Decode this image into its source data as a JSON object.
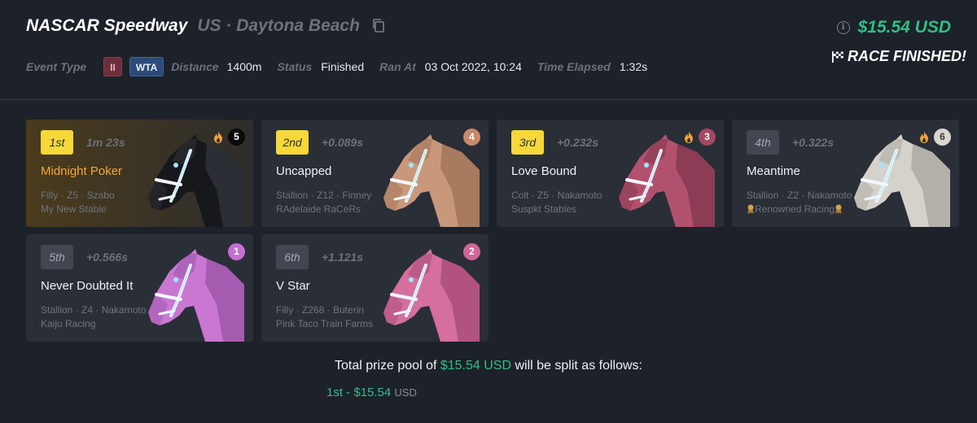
{
  "race": {
    "track": "NASCAR Speedway",
    "location": "US · Daytona Beach",
    "prize": "$15.54 USD",
    "status_banner": "RACE FINISHED!",
    "labels": {
      "event_type": "Event Type",
      "distance": "Distance",
      "status": "Status",
      "ran_at": "Ran At",
      "time_elapsed": "Time Elapsed"
    },
    "class_badge": "II",
    "event_type": "WTA",
    "distance": "1400m",
    "status": "Finished",
    "ran_at": "03 Oct 2022, 10:24",
    "time_elapsed": "1:32s"
  },
  "results": [
    {
      "position": "1st",
      "gap": "1m 23s",
      "name": "Midnight Poker",
      "meta": "Filly · Z5 · Szabo",
      "stable": "My New Stable",
      "gate": "5",
      "gate_bg": "#0a0a0a",
      "gate_fg": "#ffffff",
      "coat": "#17181c",
      "shade": "#2c2e35",
      "hot": true
    },
    {
      "position": "2nd",
      "gap": "+0.089s",
      "name": "Uncapped",
      "meta": "Stallion · Z12 · Finney",
      "stable": "RAdelaide RaCeRs",
      "gate": "4",
      "gate_bg": "#c78a68",
      "gate_fg": "#ffffff",
      "coat": "#c9987a",
      "shade": "#a87a5e",
      "hot": false
    },
    {
      "position": "3rd",
      "gap": "+0.232s",
      "name": "Love Bound",
      "meta": "Colt · Z5 · Nakamoto",
      "stable": "Suspkt Stables",
      "gate": "3",
      "gate_bg": "#a24a63",
      "gate_fg": "#ffffff",
      "coat": "#b2516d",
      "shade": "#8c3c54",
      "hot": true
    },
    {
      "position": "4th",
      "gap": "+0.322s",
      "name": "Meantime",
      "meta": "Stallion · Z2 · Nakamoto",
      "stable": "Renowned Racing",
      "gate": "6",
      "gate_bg": "#d9d6cf",
      "gate_fg": "#3a3a3a",
      "coat": "#d5d2cb",
      "shade": "#b3b0a8",
      "hot": true,
      "ribbons": true
    },
    {
      "position": "5th",
      "gap": "+0.566s",
      "name": "Never Doubted It",
      "meta": "Stallion · Z4 · Nakamoto",
      "stable": "Kaiju Racing",
      "gate": "1",
      "gate_bg": "#c66fd2",
      "gate_fg": "#ffffff",
      "coat": "#c977d2",
      "shade": "#a55bb0",
      "hot": false
    },
    {
      "position": "6th",
      "gap": "+1.121s",
      "name": "V Star",
      "meta": "Filly · Z268 · Buterin",
      "stable": "Pink Taco Train Farms",
      "gate": "2",
      "gate_bg": "#d0669a",
      "gate_fg": "#ffffff",
      "coat": "#d46f9e",
      "shade": "#b2537f",
      "hot": false
    }
  ],
  "prize_split": {
    "prefix": "Total prize pool of",
    "amount": "$15.54 USD",
    "suffix": "will be split as follows:",
    "payouts": [
      {
        "place": "1st",
        "amount": "$15.54",
        "unit": "USD"
      }
    ]
  },
  "colors": {
    "accent_green": "#2fbf86",
    "gold": "#f6d83a",
    "winner_name": "#f3a83a"
  }
}
